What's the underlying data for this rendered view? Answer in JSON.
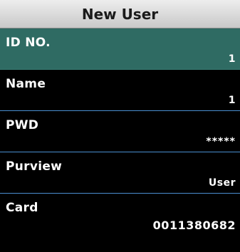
{
  "header": {
    "title": "New User"
  },
  "fields": [
    {
      "label": "ID NO.",
      "value": "1"
    },
    {
      "label": "Name",
      "value": "1"
    },
    {
      "label": "PWD",
      "value": "*****"
    },
    {
      "label": "Purview",
      "value": "User"
    },
    {
      "label": "Card",
      "value": "0011380682"
    }
  ],
  "colors": {
    "selected_row": "#2f6b63",
    "divider": "#4a8fd0",
    "background": "#000000"
  }
}
